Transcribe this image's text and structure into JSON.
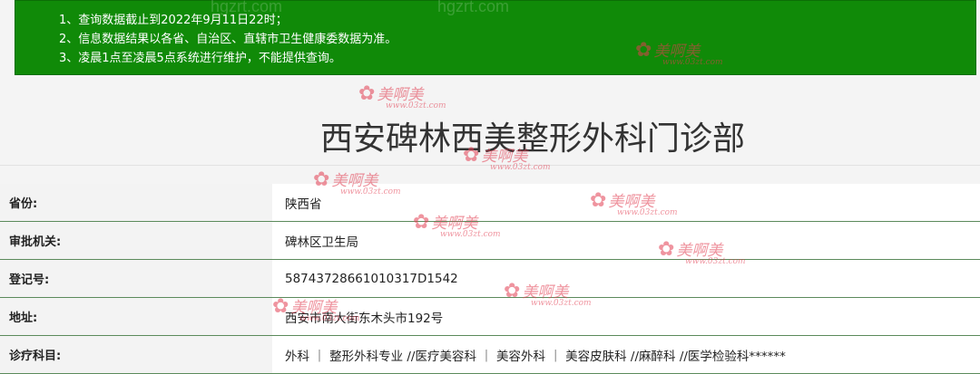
{
  "notice": {
    "lines": [
      "1、查询数据截止到2022年9月11日22时；",
      "2、信息数据结果以各省、自治区、直辖市卫生健康委数据为准。",
      "3、凌晨1点至凌晨5点系统进行维护，不能提供查询。"
    ],
    "watermark": "hgzrt.com"
  },
  "page_title": "西安碑林西美整形外科门诊部",
  "fields": [
    {
      "label": "省份:",
      "value": "陕西省"
    },
    {
      "label": "审批机关:",
      "value": "碑林区卫生局"
    },
    {
      "label": "登记号:",
      "value": "58743728661010317D1542"
    },
    {
      "label": "地址:",
      "value": "西安市南大街东木头市192号"
    },
    {
      "label": "诊疗科目:",
      "value": "外科 ｜ 整形外科专业 //医疗美容科 ｜ 美容外科 ｜ 美容皮肤科 //麻醉科 //医学检验科******"
    }
  ],
  "watermark": {
    "text": "美啊美",
    "sub": "www.03zt.com",
    "icon": "flower-icon"
  },
  "colors": {
    "notice_bg": "#108a08",
    "row_border": "#5b8a5b"
  }
}
